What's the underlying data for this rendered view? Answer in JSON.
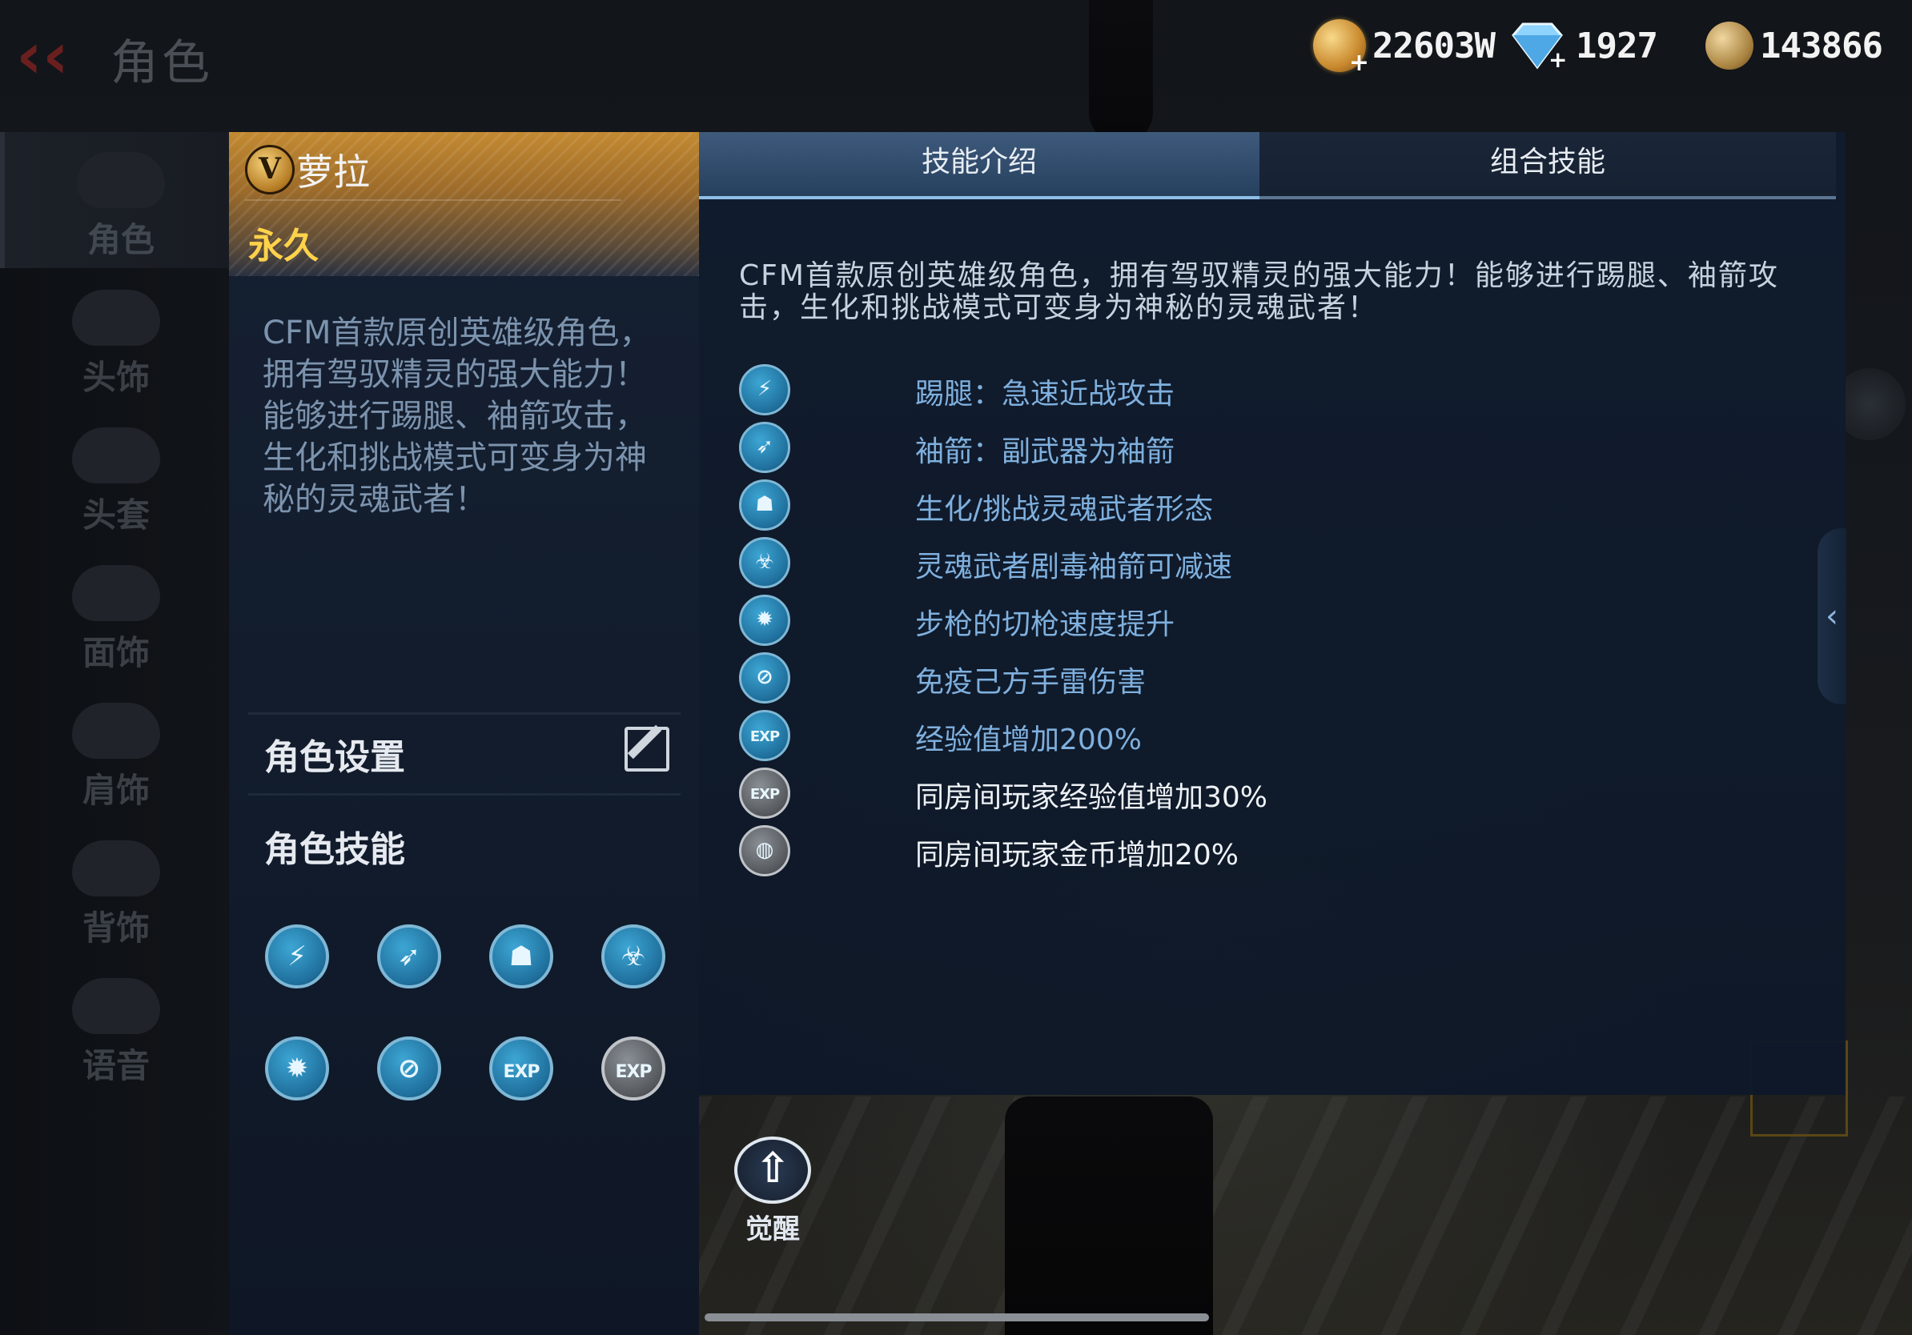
{
  "topbar": {
    "title": "角色",
    "currencies": [
      {
        "icon": "gold-coin-add-icon",
        "value": "22603W"
      },
      {
        "icon": "diamond-add-icon",
        "value": "1927"
      },
      {
        "icon": "crossed-swords-token-icon",
        "value": "143866"
      }
    ]
  },
  "sidebar": {
    "items": [
      {
        "label": "角色",
        "icon": "character-icon"
      },
      {
        "label": "头饰",
        "icon": "headwear-icon"
      },
      {
        "label": "头套",
        "icon": "headgear-icon"
      },
      {
        "label": "面饰",
        "icon": "face-accessory-icon"
      },
      {
        "label": "肩饰",
        "icon": "shoulder-accessory-icon"
      },
      {
        "label": "背饰",
        "icon": "back-accessory-icon"
      },
      {
        "label": "语音",
        "icon": "voice-icon"
      }
    ]
  },
  "card": {
    "badge": "V",
    "name": "萝拉",
    "duration": "永久",
    "description": "CFM首款原创英雄级角色，拥有驾驭精灵的强大能力！能够进行踢腿、袖箭攻击，生化和挑战模式可变身为神秘的灵魂武者！",
    "settings_label": "角色设置",
    "skills_label": "角色技能"
  },
  "tabs": {
    "intro": "技能介绍",
    "combo": "组合技能"
  },
  "intro_text": "CFM首款原创英雄级角色，拥有驾驭精灵的强大能力！能够进行踢腿、袖箭攻击，生化和挑战模式可变身为神秘的灵魂武者！",
  "skills": [
    {
      "icon": "kick-icon",
      "glyph": "⚡",
      "text": "踢腿：急速近战攻击",
      "highlight": false
    },
    {
      "icon": "sleeve-arrow-icon",
      "glyph": "➶",
      "text": "袖箭：副武器为袖箭",
      "highlight": false
    },
    {
      "icon": "soul-warrior-icon",
      "glyph": "☗",
      "text": "生化/挑战灵魂武者形态",
      "highlight": false
    },
    {
      "icon": "poison-slow-icon",
      "glyph": "☣",
      "text": "灵魂武者剧毒袖箭可减速",
      "highlight": false
    },
    {
      "icon": "rifle-switch-icon",
      "glyph": "✹",
      "text": "步枪的切枪速度提升",
      "highlight": false
    },
    {
      "icon": "grenade-immune-icon",
      "glyph": "⊘",
      "text": "免疫己方手雷伤害",
      "highlight": false
    },
    {
      "icon": "exp-boost-icon",
      "glyph": "EXP",
      "text": "经验值增加200%",
      "highlight": false
    },
    {
      "icon": "room-exp-boost-icon",
      "glyph": "EXP",
      "text": "同房间玩家经验值增加30%",
      "highlight": true
    },
    {
      "icon": "room-gold-boost-icon",
      "glyph": "◍",
      "text": "同房间玩家金币增加20%",
      "highlight": true
    }
  ],
  "awaken_label": "觉醒"
}
